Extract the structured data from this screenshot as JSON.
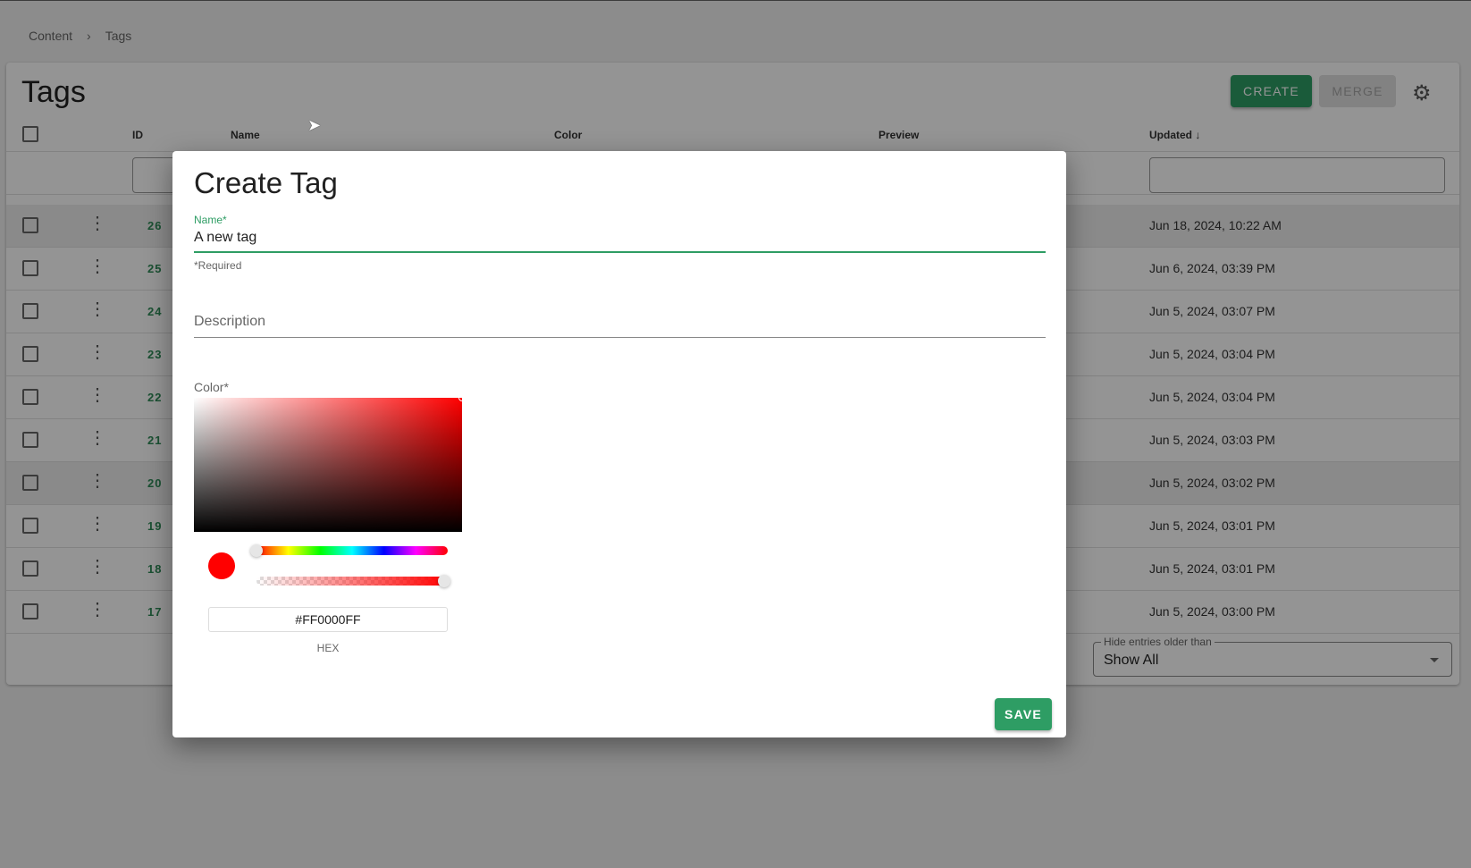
{
  "breadcrumb": [
    "Content",
    "Tags"
  ],
  "page": {
    "title": "Tags",
    "create_label": "CREATE",
    "merge_label": "MERGE"
  },
  "table": {
    "columns": {
      "id": "ID",
      "name": "Name",
      "color": "Color",
      "preview": "Preview",
      "updated": "Updated ↓"
    },
    "rows": [
      {
        "id": "26",
        "updated": "Jun 18, 2024, 10:22 AM"
      },
      {
        "id": "25",
        "updated": "Jun 6, 2024, 03:39 PM"
      },
      {
        "id": "24",
        "updated": "Jun 5, 2024, 03:07 PM"
      },
      {
        "id": "23",
        "updated": "Jun 5, 2024, 03:04 PM"
      },
      {
        "id": "22",
        "updated": "Jun 5, 2024, 03:04 PM"
      },
      {
        "id": "21",
        "updated": "Jun 5, 2024, 03:03 PM"
      },
      {
        "id": "20",
        "updated": "Jun 5, 2024, 03:02 PM"
      },
      {
        "id": "19",
        "updated": "Jun 5, 2024, 03:01 PM"
      },
      {
        "id": "18",
        "updated": "Jun 5, 2024, 03:01 PM"
      },
      {
        "id": "17",
        "updated": "Jun 5, 2024, 03:00 PM"
      }
    ]
  },
  "hide_filter": {
    "label": "Hide entries older than",
    "value": "Show All"
  },
  "dialog": {
    "title": "Create Tag",
    "name_label": "Name*",
    "name_value": "A new tag",
    "required_note": "*Required",
    "description_placeholder": "Description",
    "color_label": "Color*",
    "hex_value": "#FF0000FF",
    "hex_label": "HEX",
    "hue_fraction": 0,
    "alpha_fraction": 1,
    "save_label": "SAVE"
  },
  "colors": {
    "accent": "#2e9d64",
    "selected_color": "#FF0000"
  }
}
